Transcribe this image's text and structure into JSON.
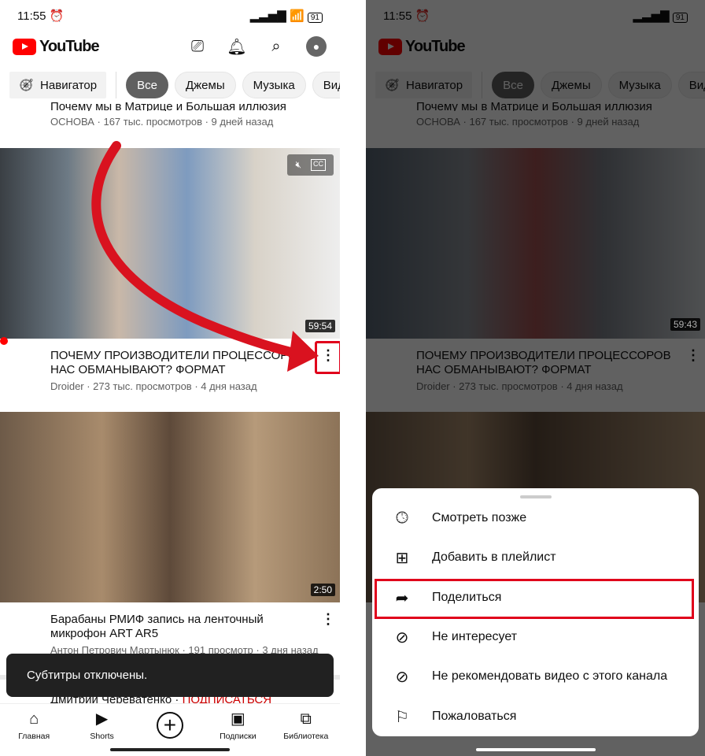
{
  "status": {
    "time": "11:55",
    "battery": "91"
  },
  "header": {
    "logo": "YouTube"
  },
  "chips": [
    "Навигатор",
    "Все",
    "Джемы",
    "Музыка",
    "Вид"
  ],
  "videos": [
    {
      "title": "Почему мы в Матрице и Большая иллюзия",
      "meta": "ОСНОВА · 167 тыс. просмотров · 9 дней назад"
    },
    {
      "title": "ПОЧЕМУ ПРОИЗВОДИТЕЛИ ПРОЦЕССОРОВ НАС ОБМАНЫВАЮТ? ФОРМАТ",
      "meta": "Droider · 273 тыс. просмотров · 4 дня назад",
      "duration_left": "59:54",
      "duration_right": "59:43"
    },
    {
      "title": "Барабаны РМИФ запись на ленточный микрофон ART AR5",
      "meta": "Антон Петрович Мартынюк · 191 просмотр · 3 дня назад",
      "duration": "2:50"
    },
    {
      "channel": "Дмитрий Череватенко ·",
      "subscribe": "ПОДПИСАТЬСЯ"
    }
  ],
  "toast": "Субтитры отключены.",
  "bottom_nav": [
    "Главная",
    "Shorts",
    "",
    "Подписки",
    "Библиотека"
  ],
  "menu": [
    "Смотреть позже",
    "Добавить в плейлист",
    "Поделиться",
    "Не интересует",
    "Не рекомендовать видео с этого канала",
    "Пожаловаться"
  ],
  "colors": {
    "brand": "#ff0000",
    "highlight": "#e0001b",
    "subscribe": "#cc0000"
  }
}
